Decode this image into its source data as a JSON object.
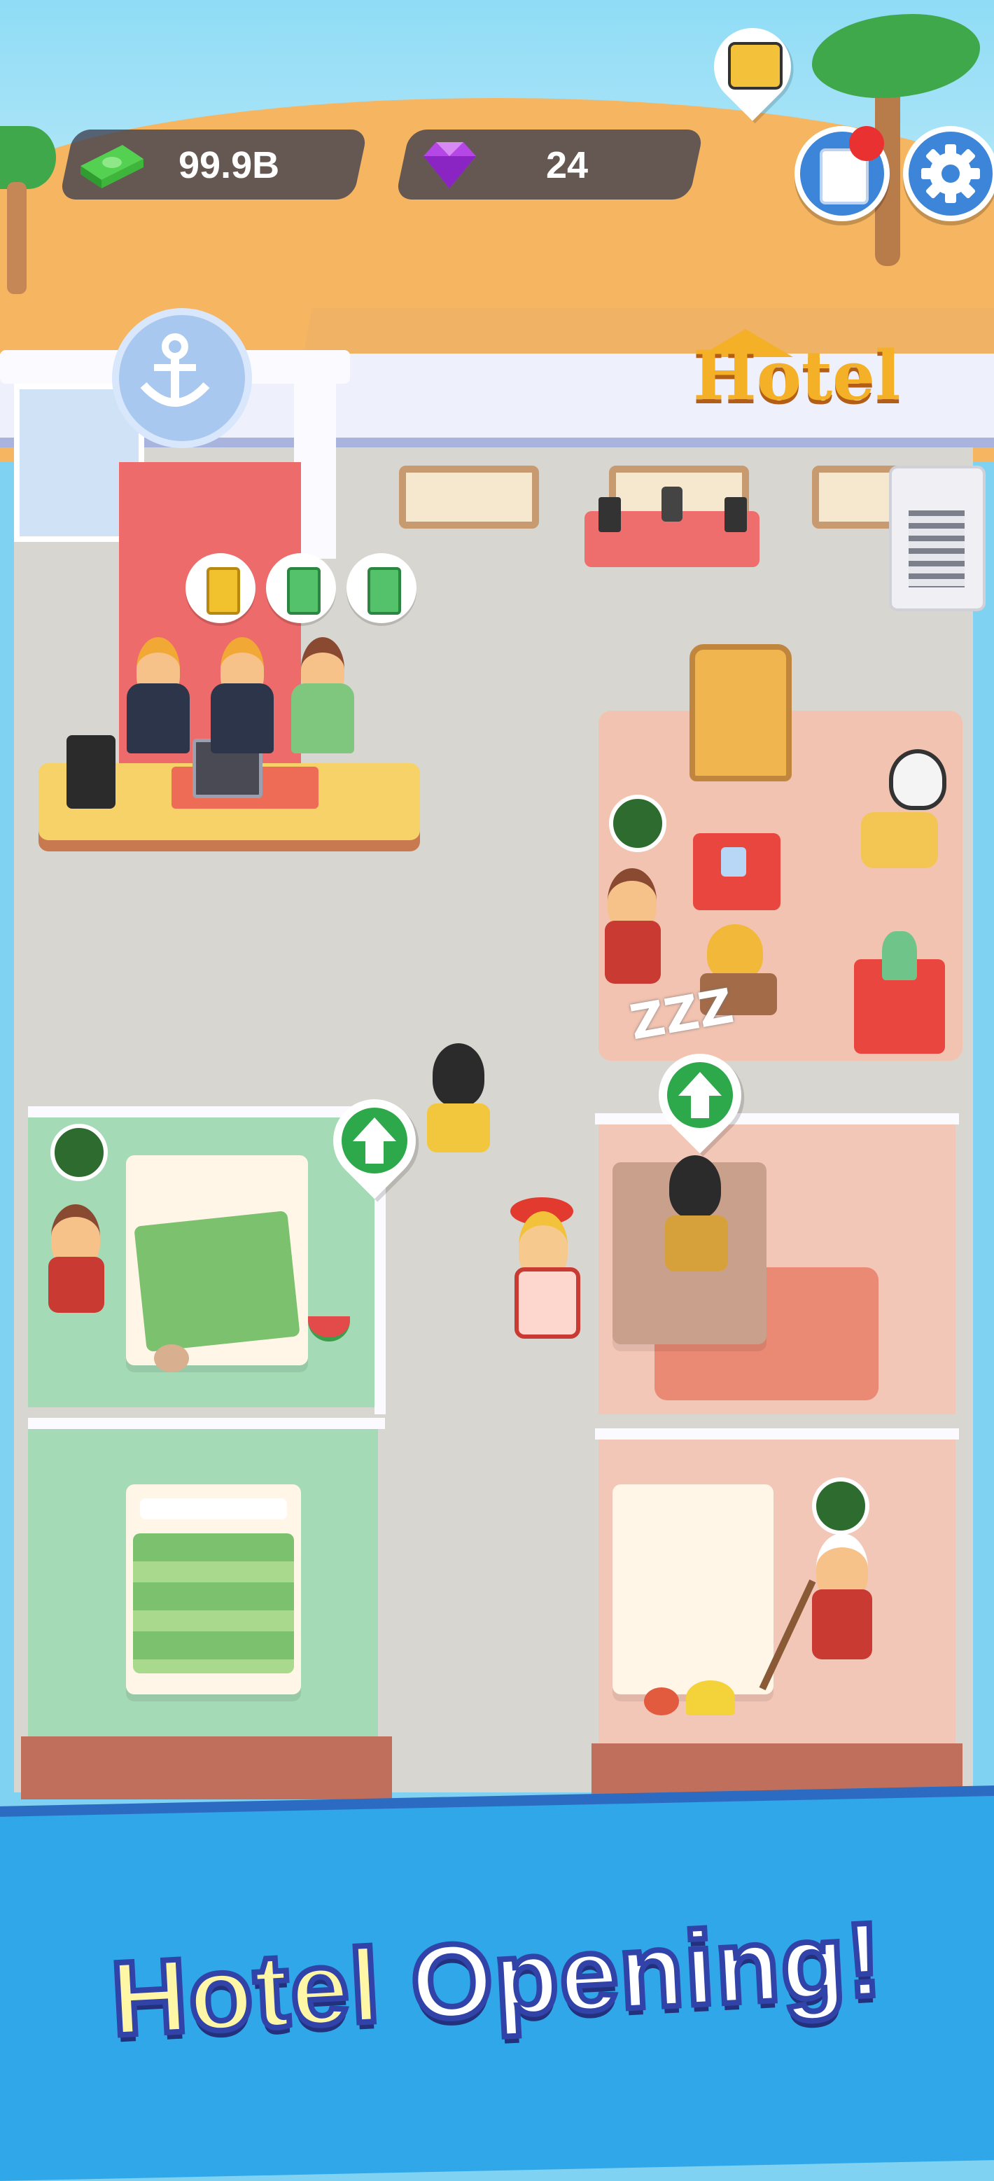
{
  "hud": {
    "cash_value": "99.9B",
    "gems_value": "24",
    "cash_icon": "cash-stack-icon",
    "gem_icon": "purple-gem-icon",
    "tasks_icon": "clipboard-icon",
    "settings_icon": "gear-icon",
    "shop_icon": "cash-register-icon"
  },
  "hotel_sign": "Hotel",
  "banner": {
    "word1": "Hotel",
    "word2": "Opening!"
  },
  "colors": {
    "banner_blue": "#2fa7e8",
    "banner_title_fill": "#fff6a6",
    "gem": "#a43be0",
    "cash": "#3fbf3f",
    "sand": "#f5b561"
  },
  "scene": {
    "upgrade_icon": "green-up-arrow-icon",
    "sleep_text": "ZZZ"
  }
}
